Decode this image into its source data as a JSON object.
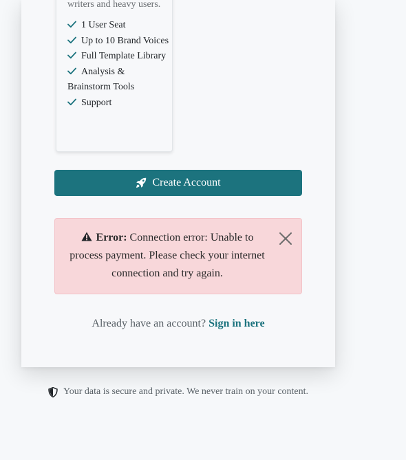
{
  "plan": {
    "description": "writers and heavy users.",
    "features": [
      {
        "label": "1 User Seat"
      },
      {
        "label": "Up to 10 Brand Voices"
      },
      {
        "label": "Full Template Library"
      },
      {
        "label": "Analysis & Brainstorm Tools"
      },
      {
        "label": "Support"
      }
    ]
  },
  "create_button": {
    "label": "Create Account",
    "icon": "rocket-icon",
    "color": "#1c737e"
  },
  "error_alert": {
    "icon": "warning-icon",
    "title": "Error:",
    "message": "Connection error: Unable to process payment. Please check your internet connection and try again.",
    "background": "#f8d7da"
  },
  "signin": {
    "prompt": "Already have an account?",
    "link_label": "Sign in here"
  },
  "footer": {
    "icon": "shield-icon",
    "note": "Your data is secure and private. We never train on your content."
  }
}
